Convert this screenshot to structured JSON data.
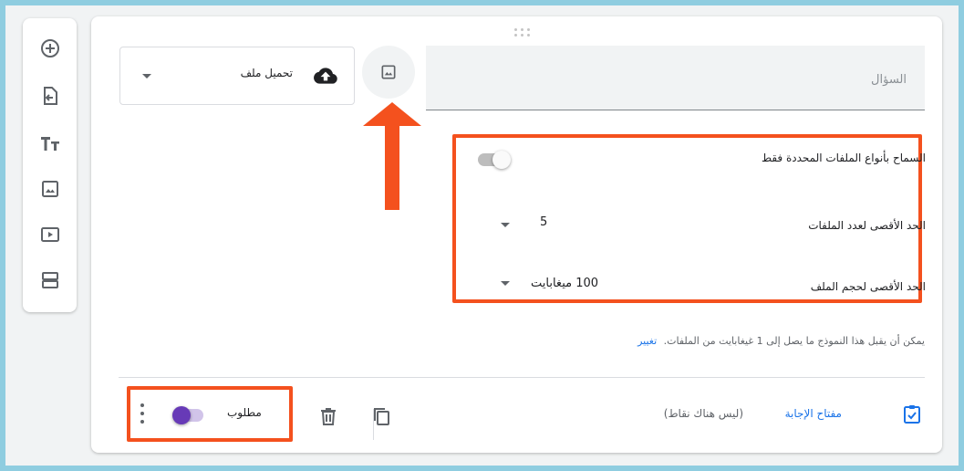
{
  "question": {
    "placeholder": "السؤال"
  },
  "question_type": {
    "selected": "تحميل ملف",
    "icon": "cloud-upload-icon"
  },
  "settings": {
    "allow_specific_types_label": "السماح بأنواع الملفات المحددة فقط",
    "allow_specific_types_enabled": false,
    "max_files_label": "الحد الأقصى لعدد الملفات",
    "max_files_value": "5",
    "max_size_label": "الحد الأقصى لحجم الملف",
    "max_size_value": "100 ميغابايت"
  },
  "limit_note": {
    "text": "يمكن أن يقبل هذا النموذج ما يصل إلى 1 غيغابايت من الملفات.",
    "link": "تغيير"
  },
  "footer": {
    "answer_key": "مفتاح الإجابة",
    "points": "(ليس هناك نقاط)",
    "required_label": "مطلوب",
    "required_enabled": true
  },
  "sidebar_tools": [
    "add-question-icon",
    "import-questions-icon",
    "title-text-icon",
    "image-icon",
    "video-icon",
    "section-icon"
  ],
  "colors": {
    "accent": "#673ab7",
    "link": "#1a73e8",
    "highlight": "#f4511e",
    "outer_border": "#8fcde0"
  }
}
